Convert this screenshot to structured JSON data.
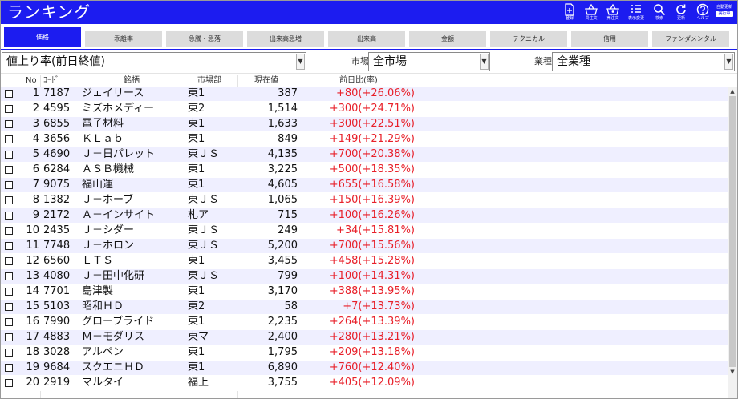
{
  "app": {
    "title": "ランキング"
  },
  "toolbar": {
    "register_label": "登録",
    "buy_label": "買注文",
    "sell_label": "売注文",
    "display_label": "表示変更",
    "search_label": "検索",
    "refresh_label": "更新",
    "help_label": "ヘルプ",
    "auto_update_label": "自動更新",
    "auto_update_state": "実行中"
  },
  "tabs": [
    {
      "label": "価格",
      "active": true
    },
    {
      "label": "乖離率",
      "active": false
    },
    {
      "label": "急騰・急落",
      "active": false
    },
    {
      "label": "出来高急増",
      "active": false
    },
    {
      "label": "出来高",
      "active": false
    },
    {
      "label": "金額",
      "active": false
    },
    {
      "label": "テクニカル",
      "active": false
    },
    {
      "label": "信用",
      "active": false
    },
    {
      "label": "ファンダメンタル",
      "active": false
    }
  ],
  "filters": {
    "ranking_type": "値上り率(前日終値)",
    "market_label": "市場",
    "market_value": "全市場",
    "industry_label": "業種",
    "industry_value": "全業種"
  },
  "columns": {
    "no": "No",
    "code": "ｺｰﾄﾞ",
    "name": "銘柄",
    "market": "市場部",
    "price": "現在値",
    "change": "前日比(率)"
  },
  "rows": [
    {
      "no": "1",
      "code": "7187",
      "name": "ジェイリース",
      "market": "東1",
      "price": "387",
      "change": "+80(+26.06%)"
    },
    {
      "no": "2",
      "code": "4595",
      "name": "ミズホメディー",
      "market": "東2",
      "price": "1,514",
      "change": "+300(+24.71%)"
    },
    {
      "no": "3",
      "code": "6855",
      "name": "電子材料",
      "market": "東1",
      "price": "1,633",
      "change": "+300(+22.51%)"
    },
    {
      "no": "4",
      "code": "3656",
      "name": "ＫＬａｂ",
      "market": "東1",
      "price": "849",
      "change": "+149(+21.29%)"
    },
    {
      "no": "5",
      "code": "4690",
      "name": "Ｊ－日パレット",
      "market": "東ＪＳ",
      "price": "4,135",
      "change": "+700(+20.38%)"
    },
    {
      "no": "6",
      "code": "6284",
      "name": "ＡＳＢ機械",
      "market": "東1",
      "price": "3,225",
      "change": "+500(+18.35%)"
    },
    {
      "no": "7",
      "code": "9075",
      "name": "福山運",
      "market": "東1",
      "price": "4,605",
      "change": "+655(+16.58%)"
    },
    {
      "no": "8",
      "code": "1382",
      "name": "Ｊ－ホーブ",
      "market": "東ＪＳ",
      "price": "1,065",
      "change": "+150(+16.39%)"
    },
    {
      "no": "9",
      "code": "2172",
      "name": "Ａ－インサイト",
      "market": "札ア",
      "price": "715",
      "change": "+100(+16.26%)"
    },
    {
      "no": "10",
      "code": "2435",
      "name": "Ｊ－シダー",
      "market": "東ＪＳ",
      "price": "249",
      "change": "+34(+15.81%)"
    },
    {
      "no": "11",
      "code": "7748",
      "name": "Ｊ－ホロン",
      "market": "東ＪＳ",
      "price": "5,200",
      "change": "+700(+15.56%)"
    },
    {
      "no": "12",
      "code": "6560",
      "name": "ＬＴＳ",
      "market": "東1",
      "price": "3,455",
      "change": "+458(+15.28%)"
    },
    {
      "no": "13",
      "code": "4080",
      "name": "Ｊ－田中化研",
      "market": "東ＪＳ",
      "price": "799",
      "change": "+100(+14.31%)"
    },
    {
      "no": "14",
      "code": "7701",
      "name": "島津製",
      "market": "東1",
      "price": "3,170",
      "change": "+388(+13.95%)"
    },
    {
      "no": "15",
      "code": "5103",
      "name": "昭和ＨＤ",
      "market": "東2",
      "price": "58",
      "change": "+7(+13.73%)"
    },
    {
      "no": "16",
      "code": "7990",
      "name": "グローブライド",
      "market": "東1",
      "price": "2,235",
      "change": "+264(+13.39%)"
    },
    {
      "no": "17",
      "code": "4883",
      "name": "Ｍ－モダリス",
      "market": "東マ",
      "price": "2,400",
      "change": "+280(+13.21%)"
    },
    {
      "no": "18",
      "code": "3028",
      "name": "アルペン",
      "market": "東1",
      "price": "1,795",
      "change": "+209(+13.18%)"
    },
    {
      "no": "19",
      "code": "9684",
      "name": "スクエニＨＤ",
      "market": "東1",
      "price": "6,890",
      "change": "+760(+12.40%)"
    },
    {
      "no": "20",
      "code": "2919",
      "name": "マルタイ",
      "market": "福上",
      "price": "3,755",
      "change": "+405(+12.09%)"
    }
  ]
}
